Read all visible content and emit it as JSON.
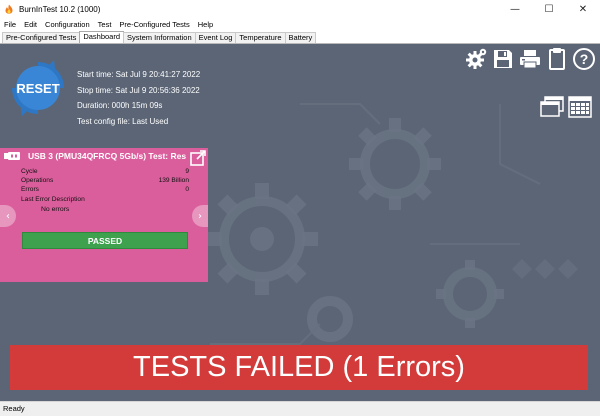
{
  "window": {
    "title": "BurnInTest 10.2 (1000)",
    "minimize": "—",
    "maximize": "☐",
    "close": "✕"
  },
  "menu": [
    "File",
    "Edit",
    "Configuration",
    "Test",
    "Pre-Configured Tests",
    "Help"
  ],
  "tabs": [
    {
      "label": "Pre-Configured Tests",
      "active": false
    },
    {
      "label": "Dashboard",
      "active": true
    },
    {
      "label": "System Information",
      "active": false
    },
    {
      "label": "Event Log",
      "active": false
    },
    {
      "label": "Temperature",
      "active": false
    },
    {
      "label": "Battery",
      "active": false
    }
  ],
  "dashboard": {
    "reset_label": "RESET",
    "start_time": "Start time: Sat Jul  9 20:41:27 2022",
    "stop_time": "Stop time: Sat Jul  9 20:56:36 2022",
    "duration": "Duration: 000h 15m 09s",
    "config_file": "Test config file: Last Used"
  },
  "test_panel": {
    "title": "USB 3 (PMU34QFRCQ 5Gb/s) Test: Res",
    "stats": [
      {
        "label": "Cycle",
        "value": "9"
      },
      {
        "label": "Operations",
        "value": "139 Billion"
      },
      {
        "label": "Errors",
        "value": "0"
      },
      {
        "label": "Last Error Description",
        "value": ""
      }
    ],
    "last_error": "No errors",
    "status": "PASSED"
  },
  "result_banner": "TESTS FAILED (1 Errors)",
  "statusbar": "Ready",
  "colors": {
    "background": "#5b6575",
    "panel": "#db5e9c",
    "passed": "#3da14e",
    "failed": "#d33b3b",
    "reset_blue": "#2e77c4"
  },
  "icons": [
    "flame-icon",
    "gear-icon",
    "save-icon",
    "printer-icon",
    "clipboard-icon",
    "help-icon",
    "window-layout-icon",
    "grid-layout-icon",
    "usb-icon",
    "export-icon"
  ]
}
